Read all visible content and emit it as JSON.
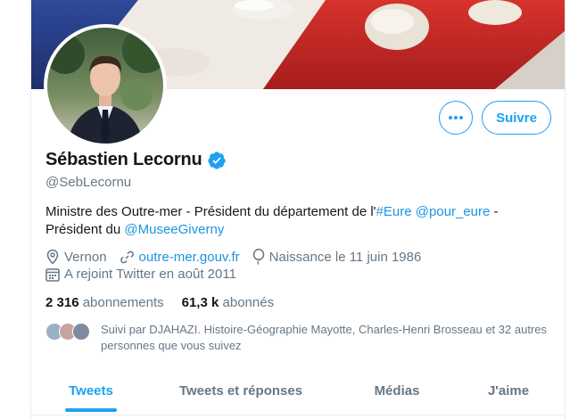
{
  "profile": {
    "name": "Sébastien Lecornu",
    "handle": "@SebLecornu",
    "verified": true,
    "bio": {
      "line1_text": "Ministre des Outre-mer - Président du département de l'",
      "hashtag": "#Eure",
      "mention1": "@pour_eure",
      "line1_tail": " -",
      "line2_text": "Président du ",
      "mention2": "@MuseeGiverny"
    },
    "location": "Vernon",
    "website": "outre-mer.gouv.fr",
    "birth": "Naissance le 11 juin 1986",
    "joined": "A rejoint Twitter en août 2011"
  },
  "counts": {
    "following_value": "2 316",
    "following_label": "abonnements",
    "followers_value": "61,3 k",
    "followers_label": "abonnés"
  },
  "followed_by": {
    "text": "Suivi par DJAHAZI. Histoire-Géographie Mayotte, Charles-Henri Brosseau et 32 autres personnes que vous suivez"
  },
  "actions": {
    "more_icon": "ellipsis-icon",
    "follow_label": "Suivre"
  },
  "tabs": [
    {
      "label": "Tweets",
      "active": true
    },
    {
      "label": "Tweets et réponses",
      "active": false
    },
    {
      "label": "Médias",
      "active": false
    },
    {
      "label": "J'aime",
      "active": false
    }
  ],
  "colors": {
    "accent": "#1da1f2",
    "link": "#1b95e0",
    "secondary_text": "#657786",
    "primary_text": "#14171a"
  },
  "icons": {
    "location": "map-pin-icon",
    "website": "link-icon",
    "birth": "balloon-icon",
    "joined": "calendar-icon",
    "verified": "verified-badge-icon"
  }
}
